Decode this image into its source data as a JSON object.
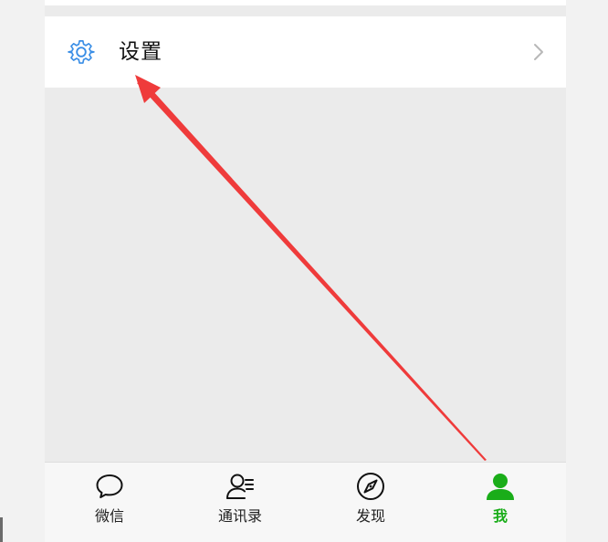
{
  "settings_row": {
    "label": "设置",
    "icon": "gear-icon",
    "chevron_icon": "chevron-right-icon"
  },
  "tabbar": {
    "items": [
      {
        "label": "微信",
        "icon": "chat-bubble-icon",
        "active": false
      },
      {
        "label": "通讯录",
        "icon": "contacts-icon",
        "active": false
      },
      {
        "label": "发现",
        "icon": "compass-icon",
        "active": false
      },
      {
        "label": "我",
        "icon": "person-icon",
        "active": true
      }
    ]
  },
  "colors": {
    "accent_green": "#1aad19",
    "icon_blue": "#3a8ee6",
    "annotation_red": "#ef3b3b",
    "text_dark": "#111111",
    "background_gray": "#ebebeb"
  }
}
